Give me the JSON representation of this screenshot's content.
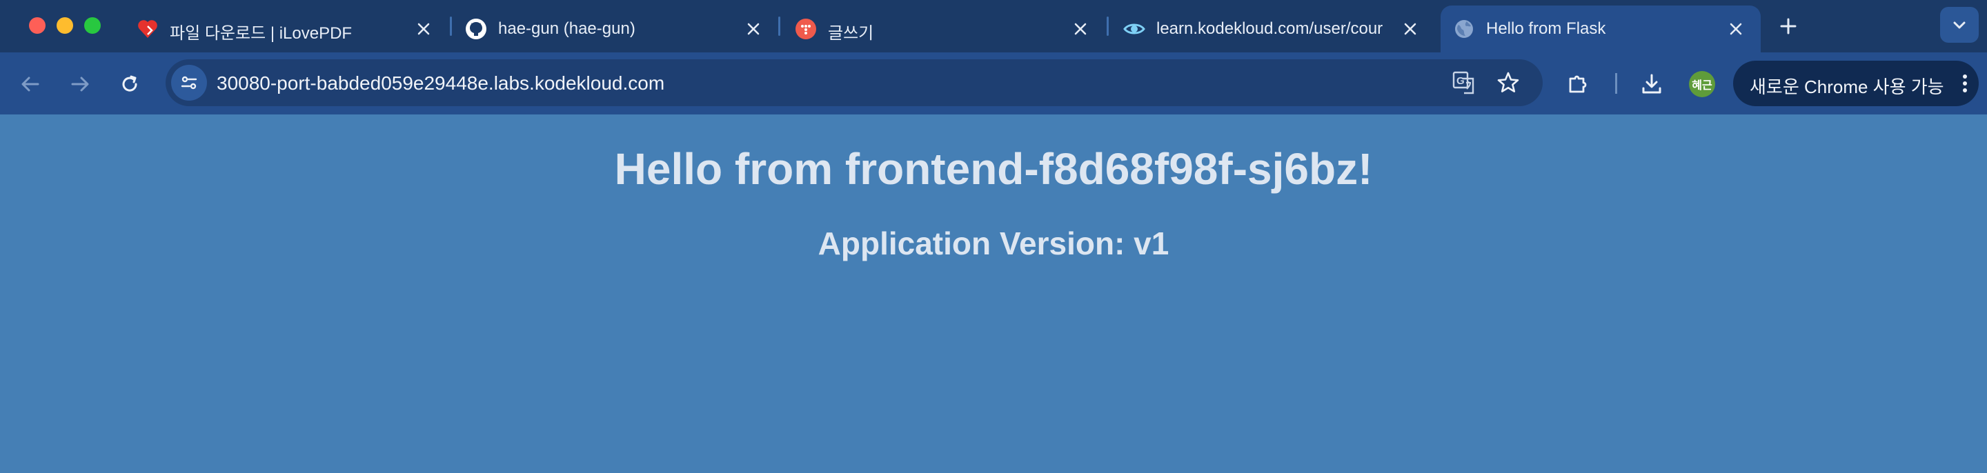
{
  "browser": {
    "tabs": [
      {
        "title": "파일 다운로드 | iLovePDF",
        "icon": "ilovepdf-icon"
      },
      {
        "title": "hae-gun (hae-gun)",
        "icon": "github-icon"
      },
      {
        "title": "글쓰기",
        "icon": "tistory-icon"
      },
      {
        "title": "learn.kodekloud.com/user/courses",
        "icon": "kodekloud-icon"
      },
      {
        "title": "Hello from Flask",
        "icon": "globe-icon",
        "active": true
      }
    ],
    "new_tab_label": "+",
    "url": "30080-port-babded059e29448e.labs.kodekloud.com",
    "profile_initials": "혜근",
    "update_label": "새로운 Chrome 사용 가능"
  },
  "page": {
    "heading": "Hello from frontend-f8d68f98f-sj6bz!",
    "subheading": "Application Version: v1"
  },
  "colors": {
    "tabstrip": "#1b3a67",
    "toolbar": "#254e8d",
    "page_background": "#457fb5",
    "page_text": "#dde6f1"
  }
}
